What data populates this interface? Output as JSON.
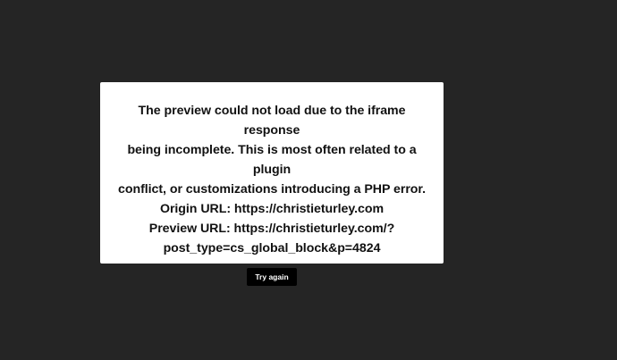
{
  "dialog": {
    "message_lines": [
      "The preview could not load due to the iframe response",
      "being incomplete. This is most often related to a plugin",
      "conflict, or customizations introducing a PHP error.",
      "Origin URL: https://christieturley.com",
      "Preview URL: https://christieturley.com/?",
      "post_type=cs_global_block&p=4824"
    ],
    "button_label": "Try again"
  },
  "colors": {
    "background": "#252525",
    "dialog_background": "#ffffff",
    "text": "#111111",
    "button_background": "#000000",
    "button_text": "#ffffff"
  }
}
